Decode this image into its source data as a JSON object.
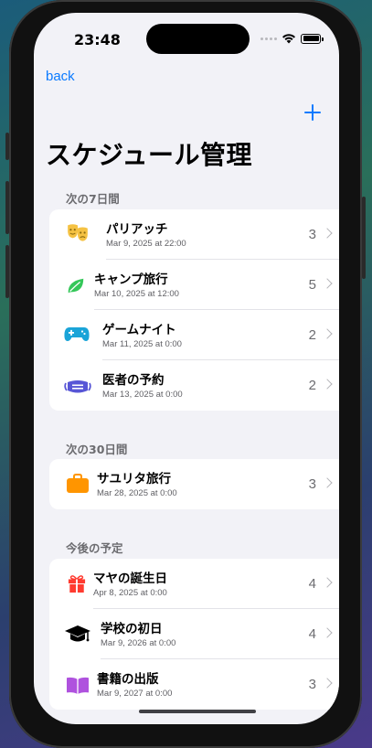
{
  "status_bar": {
    "time": "23:48"
  },
  "nav": {
    "back_label": "back"
  },
  "page": {
    "title": "スケジュール管理"
  },
  "sections": [
    {
      "header": "次の7日間",
      "items": [
        {
          "icon": "theater-masks-icon",
          "name": "パリアッチ",
          "date": "Mar 9, 2025 at 22:00",
          "count": "3"
        },
        {
          "icon": "leaf-icon",
          "name": "キャンプ旅行",
          "date": "Mar 10, 2025 at 12:00",
          "count": "5"
        },
        {
          "icon": "gamecontroller-icon",
          "name": "ゲームナイト",
          "date": "Mar 11, 2025 at 0:00",
          "count": "2"
        },
        {
          "icon": "facemask-icon",
          "name": "医者の予約",
          "date": "Mar 13, 2025 at 0:00",
          "count": "2"
        }
      ]
    },
    {
      "header": "次の30日間",
      "items": [
        {
          "icon": "suitcase-icon",
          "name": "サユリタ旅行",
          "date": "Mar 28, 2025 at 0:00",
          "count": "3"
        }
      ]
    },
    {
      "header": "今後の予定",
      "items": [
        {
          "icon": "gift-icon",
          "name": "マヤの誕生日",
          "date": "Apr 8, 2025 at 0:00",
          "count": "4"
        },
        {
          "icon": "graduationcap-icon",
          "name": "学校の初日",
          "date": "Mar 9, 2026 at 0:00",
          "count": "4"
        },
        {
          "icon": "book-icon",
          "name": "書籍の出版",
          "date": "Mar 9, 2027 at 0:00",
          "count": "3"
        }
      ]
    }
  ],
  "colors": {
    "accent": "#0a7aff",
    "theater": "#f5c243",
    "leaf": "#34c759",
    "gamecontroller": "#1aa4d8",
    "facemask": "#5856d6",
    "suitcase": "#ff9500",
    "gift": "#ff3b30",
    "graduationcap": "#000000",
    "book": "#af52de"
  }
}
